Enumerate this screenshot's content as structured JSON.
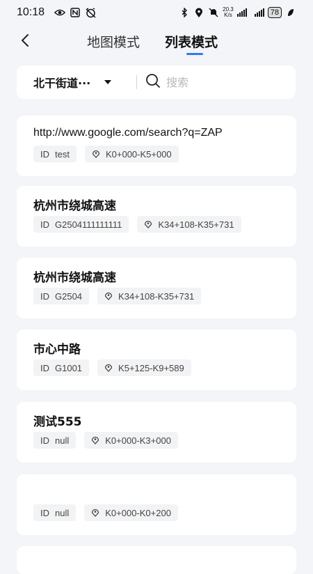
{
  "status": {
    "time": "10:18",
    "speed_value": "20.3",
    "speed_unit": "K/s",
    "battery": "78",
    "left_icons": [
      "eye-icon",
      "nfc-icon",
      "alarm-off-icon"
    ],
    "right_icons": [
      "bluetooth-icon",
      "location-icon",
      "mute-icon",
      "signal-icon",
      "signal-icon",
      "battery-icon",
      "leaf-icon"
    ]
  },
  "nav": {
    "back_icon": "chevron-left-icon",
    "tabs": [
      {
        "label": "地图模式",
        "active": false
      },
      {
        "label": "列表模式",
        "active": true
      }
    ]
  },
  "filter": {
    "region": "北干街道···",
    "search_placeholder": "搜索",
    "search_value": ""
  },
  "items": [
    {
      "title": "http://www.google.com/search?q=ZAP",
      "id_label": "ID",
      "id": "test",
      "range": "K0+000-K5+000"
    },
    {
      "title": "杭州市绕城高速",
      "id_label": "ID",
      "id": "G2504111111111",
      "range": "K34+108-K35+731"
    },
    {
      "title": "杭州市绕城高速",
      "id_label": "ID",
      "id": "G2504",
      "range": "K34+108-K35+731"
    },
    {
      "title": "市心中路",
      "id_label": "ID",
      "id": "G1001",
      "range": "K5+125-K9+589"
    },
    {
      "title": "测试555",
      "id_label": "ID",
      "id": "null",
      "range": "K0+000-K3+000"
    },
    {
      "title": "",
      "id_label": "ID",
      "id": "null",
      "range": "K0+000-K0+200"
    }
  ],
  "colors": {
    "accent": "#2f7bf5",
    "background": "#f3f5f8",
    "card": "#ffffff",
    "tag_bg": "#f2f3f5"
  }
}
